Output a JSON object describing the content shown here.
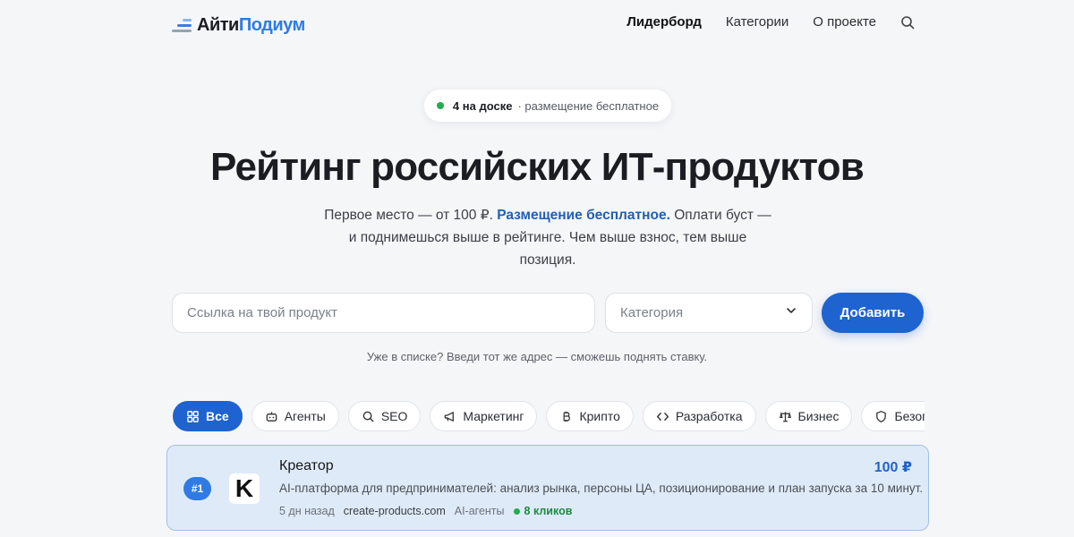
{
  "header": {
    "logo_part1": "Айти",
    "logo_part2": "Подиум",
    "nav": [
      "Лидерборд",
      "Категории",
      "О проекте"
    ]
  },
  "badge": {
    "count": "4 на доске",
    "note": "· размещение бесплатное"
  },
  "hero": {
    "title": "Рейтинг российских ИТ-продуктов",
    "subtitle_pre": "Первое место — от 100 ₽.",
    "subtitle_highlight": "Размещение бесплатное.",
    "subtitle_post": "Оплати буст — и поднимешься выше в рейтинге. Чем выше взнос, тем выше позиция."
  },
  "form": {
    "url_placeholder": "Ссылка на твой продукт",
    "category_placeholder": "Категория",
    "add_label": "Добавить",
    "hint": "Уже в списке? Введи тот же адрес — сможешь поднять ставку."
  },
  "chips": [
    {
      "label": "Все",
      "icon": "grid-icon",
      "active": true
    },
    {
      "label": "Агенты",
      "icon": "robot-icon",
      "active": false
    },
    {
      "label": "SEO",
      "icon": "search-icon",
      "active": false
    },
    {
      "label": "Маркетинг",
      "icon": "megaphone-icon",
      "active": false
    },
    {
      "label": "Крипто",
      "icon": "bitcoin-icon",
      "active": false
    },
    {
      "label": "Разработка",
      "icon": "code-icon",
      "active": false
    },
    {
      "label": "Бизнес",
      "icon": "scales-icon",
      "active": false
    },
    {
      "label": "Безопасность",
      "icon": "shield-icon",
      "active": false
    }
  ],
  "products": [
    {
      "rank": "#1",
      "logo_letter": "K",
      "name": "Креатор",
      "price": "100 ₽",
      "description": "AI-платформа для предпринимателей: анализ рынка, персоны ЦА, позиционирование и план запуска за 10 минут.",
      "age": "5 дн назад",
      "site": "create-products.com",
      "category": "AI-агенты",
      "clicks": "8 кликов"
    }
  ],
  "colors": {
    "accent": "#1e63cf",
    "card_bg": "#dfeaf8",
    "success": "#1fae4f"
  }
}
